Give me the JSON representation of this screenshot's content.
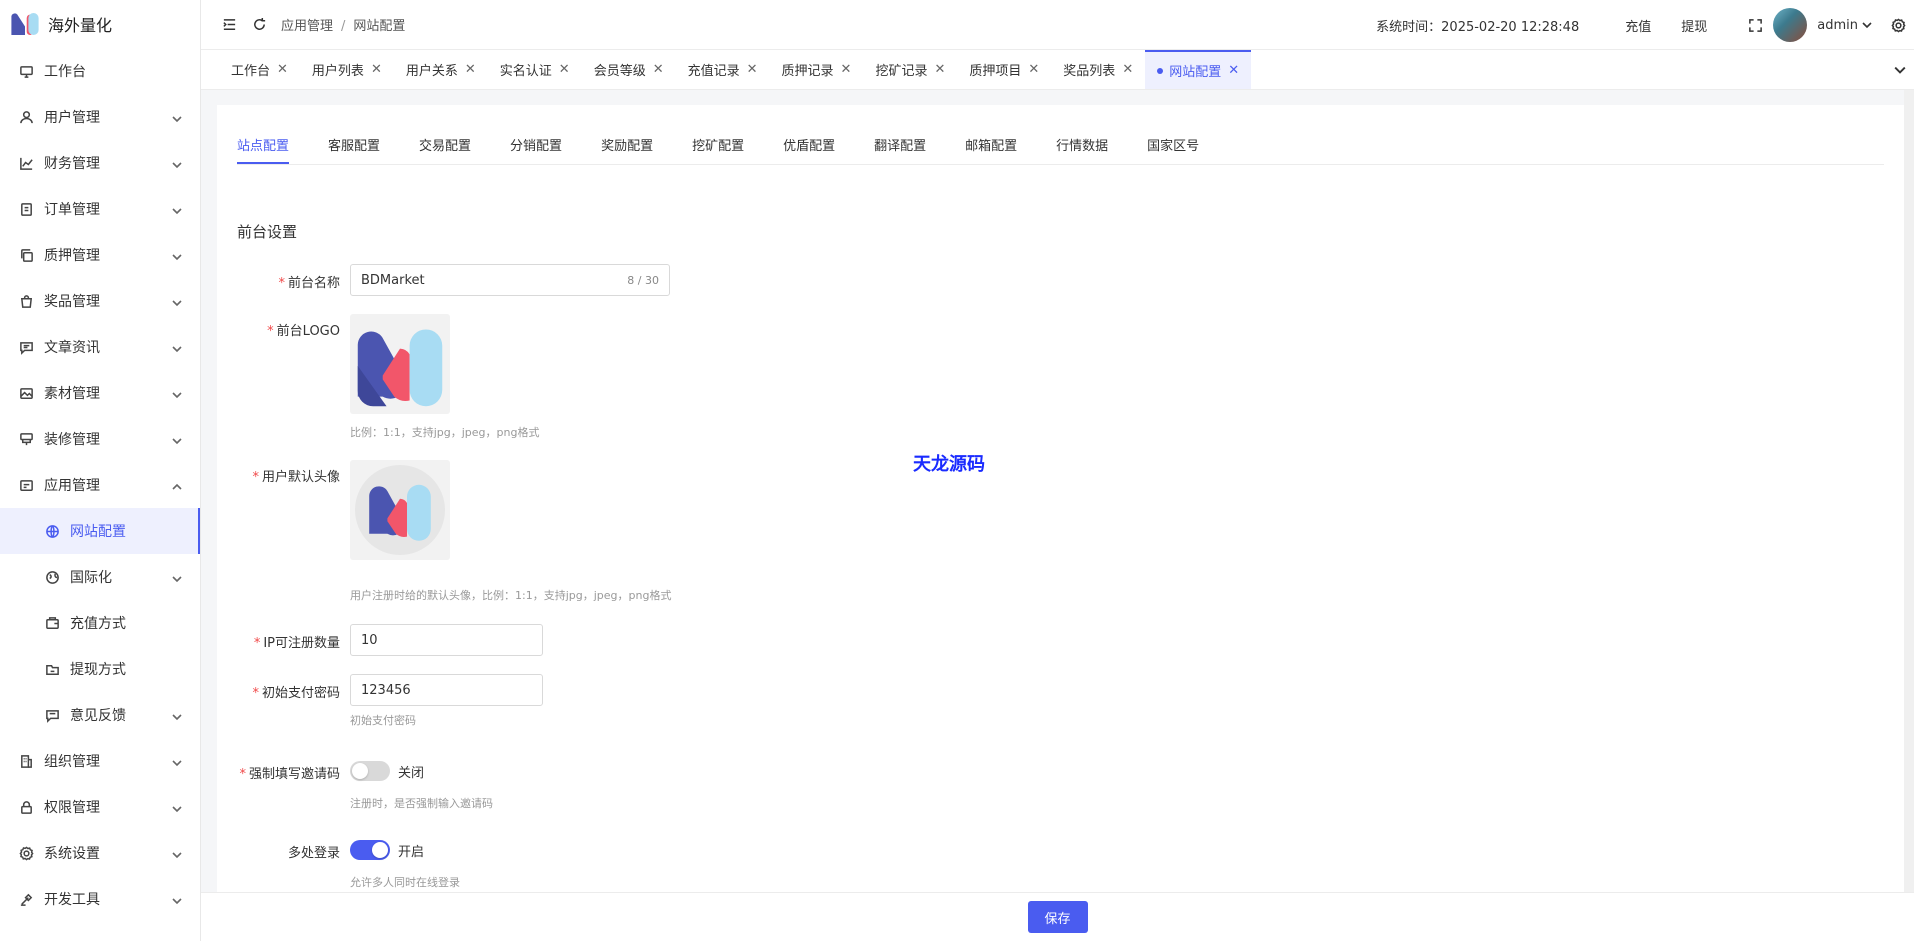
{
  "app": {
    "title": "海外量化"
  },
  "sidebar": {
    "items": [
      {
        "label": "工作台",
        "icon": "monitor-icon",
        "sub": false,
        "expand": ""
      },
      {
        "label": "用户管理",
        "icon": "user-icon",
        "sub": false,
        "expand": "down"
      },
      {
        "label": "财务管理",
        "icon": "chart-icon",
        "sub": false,
        "expand": "down"
      },
      {
        "label": "订单管理",
        "icon": "order-icon",
        "sub": false,
        "expand": "down"
      },
      {
        "label": "质押管理",
        "icon": "copy-icon",
        "sub": false,
        "expand": "down"
      },
      {
        "label": "奖品管理",
        "icon": "bag-icon",
        "sub": false,
        "expand": "down"
      },
      {
        "label": "文章资讯",
        "icon": "message-icon",
        "sub": false,
        "expand": "down"
      },
      {
        "label": "素材管理",
        "icon": "image-icon",
        "sub": false,
        "expand": "down"
      },
      {
        "label": "装修管理",
        "icon": "brush-icon",
        "sub": false,
        "expand": "down"
      },
      {
        "label": "应用管理",
        "icon": "app-icon",
        "sub": false,
        "expand": "up"
      },
      {
        "label": "网站配置",
        "icon": "globe-icon",
        "sub": true,
        "expand": "",
        "active": true
      },
      {
        "label": "国际化",
        "icon": "international-icon",
        "sub": true,
        "expand": "down"
      },
      {
        "label": "充值方式",
        "icon": "wallet-icon",
        "sub": true,
        "expand": ""
      },
      {
        "label": "提现方式",
        "icon": "folder-icon",
        "sub": true,
        "expand": ""
      },
      {
        "label": "意见反馈",
        "icon": "feedback-icon",
        "sub": true,
        "expand": "down"
      },
      {
        "label": "组织管理",
        "icon": "building-icon",
        "sub": false,
        "expand": "down"
      },
      {
        "label": "权限管理",
        "icon": "lock-icon",
        "sub": false,
        "expand": "down"
      },
      {
        "label": "系统设置",
        "icon": "gear-icon",
        "sub": false,
        "expand": "down"
      },
      {
        "label": "开发工具",
        "icon": "tool-icon",
        "sub": false,
        "expand": "down"
      }
    ]
  },
  "header": {
    "breadcrumb": [
      "应用管理",
      "网站配置"
    ],
    "breadcrumb_sep": "/",
    "systime": "系统时间：2025-02-20 12:28:48",
    "recharge": "充值",
    "withdraw": "提现",
    "user": "admin"
  },
  "tabs": [
    {
      "label": "工作台",
      "active": false
    },
    {
      "label": "用户列表",
      "active": false
    },
    {
      "label": "用户关系",
      "active": false
    },
    {
      "label": "实名认证",
      "active": false
    },
    {
      "label": "会员等级",
      "active": false
    },
    {
      "label": "充值记录",
      "active": false
    },
    {
      "label": "质押记录",
      "active": false
    },
    {
      "label": "挖矿记录",
      "active": false
    },
    {
      "label": "质押项目",
      "active": false
    },
    {
      "label": "奖品列表",
      "active": false
    },
    {
      "label": "网站配置",
      "active": true
    }
  ],
  "subtabs": [
    {
      "label": "站点配置",
      "active": true
    },
    {
      "label": "客服配置",
      "active": false
    },
    {
      "label": "交易配置",
      "active": false
    },
    {
      "label": "分销配置",
      "active": false
    },
    {
      "label": "奖励配置",
      "active": false
    },
    {
      "label": "挖矿配置",
      "active": false
    },
    {
      "label": "优盾配置",
      "active": false
    },
    {
      "label": "翻译配置",
      "active": false
    },
    {
      "label": "邮箱配置",
      "active": false
    },
    {
      "label": "行情数据",
      "active": false
    },
    {
      "label": "国家区号",
      "active": false
    }
  ],
  "form": {
    "section_title": "前台设置",
    "required_mark": "*",
    "site_name": {
      "label": "前台名称",
      "value": "BDMarket",
      "count": "8 / 30"
    },
    "logo": {
      "label": "前台LOGO",
      "hint": "比例：1:1，支持jpg，jpeg，png格式"
    },
    "avatar": {
      "label": "用户默认头像",
      "hint": "用户注册时给的默认头像，比例：1:1，支持jpg，jpeg，png格式"
    },
    "ip_limit": {
      "label": "IP可注册数量",
      "value": "10"
    },
    "pay_password": {
      "label": "初始支付密码",
      "value": "123456",
      "hint": "初始支付密码"
    },
    "force_invite": {
      "label": "强制填写邀请码",
      "state": "关闭",
      "on": false,
      "hint": "注册时，是否强制输入邀请码"
    },
    "multi_login": {
      "label": "多处登录",
      "state": "开启",
      "on": true,
      "hint": "允许多人同时在线登录"
    }
  },
  "watermark": "天龙源码",
  "footer": {
    "save": "保存"
  },
  "colors": {
    "accent": "#4a5cf0",
    "required": "#f04848"
  }
}
